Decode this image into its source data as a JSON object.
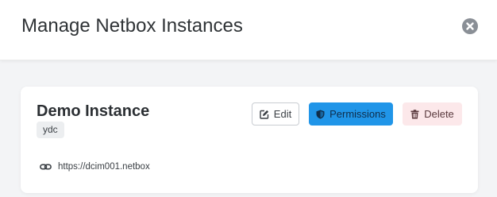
{
  "header": {
    "title": "Manage Netbox Instances"
  },
  "instance": {
    "name": "Demo Instance",
    "tag": "ydc",
    "url": "https://dcim001.netbox",
    "actions": {
      "edit_label": "Edit",
      "permissions_label": "Permissions",
      "delete_label": "Delete"
    }
  },
  "icons": {
    "close": "close-circle-icon",
    "edit": "edit-square-icon",
    "permissions": "shield-icon",
    "delete": "trash-icon",
    "url": "link-icon"
  },
  "colors": {
    "primary": "#2095e8",
    "danger_bg": "#fce8ea",
    "close_icon": "#8a8f96",
    "background": "#f3f4f6"
  }
}
